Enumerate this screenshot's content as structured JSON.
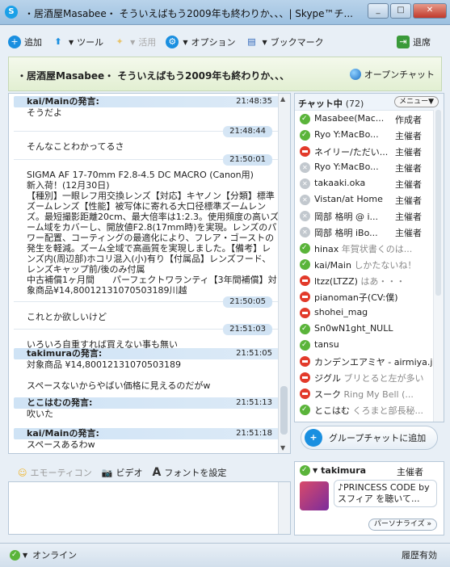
{
  "window": {
    "title": "・居酒屋Masabee・ そういえばもう2009年も終わりか、、、| Skype™チ..."
  },
  "toolbar": {
    "add": "追加",
    "tools": "ツール",
    "use": "活用",
    "options": "オプション",
    "bookmarks": "ブックマーク",
    "leave": "退席"
  },
  "topic": {
    "text": "・居酒屋Masabee・ そういえばもう2009年も終わりか、、、",
    "open_chat": "オープンチャット"
  },
  "messages": [
    {
      "sender": "kai/Mainの発言:",
      "time": "21:48:35",
      "text": "そうだよ"
    },
    {
      "sender": "",
      "time": "21:48:44",
      "text": "そんなことわかってるさ"
    },
    {
      "sender": "",
      "time": "21:50:01",
      "text": "SIGMA AF 17-70mm F2.8-4.5 DC MACRO (Canon用)\n新入荷！(12月30日)\n【種別】一眼レフ用交換レンズ【対応】キヤノン【分類】標準ズームレンズ【性能】被写体に寄れる大口径標準ズームレンズ。最短撮影距離20cm、最大倍率は1:2.3。使用頻度の高いズーム域をカバーし、開放値F2.8(17mm時)を実現。レンズのパワー配置、コーティングの最適化により、フレア・ゴーストの発生を軽減。ズーム全域で高画質を実現しました。【備考】レンズ内(周辺部)ホコリ混入(小)有り【付属品】レンズフード、レンズキャップ前/後のみ付属\n中古補償1ヶ月間　　パーフェクトワランティ【3年間補償】対象商品¥14,80012131070503189川越"
    },
    {
      "sender": "",
      "time": "21:50:05",
      "text": "これとか欲しいけど"
    },
    {
      "sender": "",
      "time": "21:51:03",
      "text": "いろいろ自重すれば買えない事も無い"
    },
    {
      "sender": "takimuraの発言:",
      "time": "21:51:05",
      "text": "対象商品 ¥14,80012131070503189\n\nスペースないからやばい価格に見えるのだがw"
    },
    {
      "sender": "とこはむの発言:",
      "time": "21:51:13",
      "text": "吹いた"
    },
    {
      "sender": "kai/Mainの発言:",
      "time": "21:51:18",
      "text": "スペースあるわw"
    }
  ],
  "input": {
    "emoticon": "エモーティコン",
    "video": "ビデオ",
    "font": "フォントを設定"
  },
  "members": {
    "label": "チャット中",
    "count": "(72)",
    "menu": "メニュー",
    "list": [
      {
        "name": "Masabee(Mac...",
        "mood": "",
        "role": "作成者",
        "status": "on"
      },
      {
        "name": "Ryo Y:MacBo...",
        "mood": "",
        "role": "主催者",
        "status": "on"
      },
      {
        "name": "ネイリー/ただい...",
        "mood": "",
        "role": "主催者",
        "status": "dnd"
      },
      {
        "name": "Ryo Y:MacBo...",
        "mood": "",
        "role": "主催者",
        "status": "off"
      },
      {
        "name": "takaaki.oka",
        "mood": "",
        "role": "主催者",
        "status": "off"
      },
      {
        "name": "Vistan/at Home",
        "mood": "",
        "role": "主催者",
        "status": "off"
      },
      {
        "name": "岡部 格明 @ i...",
        "mood": "",
        "role": "主催者",
        "status": "off"
      },
      {
        "name": "岡部 格明 iBo...",
        "mood": "",
        "role": "主催者",
        "status": "off"
      },
      {
        "name": "hinax ",
        "mood": "年賀状書くのは...",
        "role": "",
        "status": "on"
      },
      {
        "name": "kai/Main ",
        "mood": "しかたないね！",
        "role": "",
        "status": "on"
      },
      {
        "name": "ltzz(LTZZ) ",
        "mood": "はあ・・・",
        "role": "",
        "status": "dnd"
      },
      {
        "name": "pianoman子(CV:僕)",
        "mood": "",
        "role": "",
        "status": "dnd"
      },
      {
        "name": "shohei_mag",
        "mood": "",
        "role": "",
        "status": "dnd"
      },
      {
        "name": "Sn0wN1ght_NULL",
        "mood": "",
        "role": "",
        "status": "on"
      },
      {
        "name": "tansu",
        "mood": "",
        "role": "",
        "status": "on"
      },
      {
        "name": "カンデンエアミヤ - airmiya.jp",
        "mood": "",
        "role": "",
        "status": "dnd"
      },
      {
        "name": "ジグル ",
        "mood": "ブリとると左が多い",
        "role": "",
        "status": "dnd"
      },
      {
        "name": "スーク ",
        "mood": "Ring My Bell (...",
        "role": "",
        "status": "dnd"
      },
      {
        "name": "とこはむ ",
        "mood": "くろまと部長秘...",
        "role": "",
        "status": "on"
      }
    ]
  },
  "add_group": {
    "label": "グループチャットに追加"
  },
  "profile": {
    "name": "takimura",
    "role": "主催者",
    "mood": "♪PRINCESS CODE by スフィア を聴いて...",
    "button": "パーソナライズ »"
  },
  "status": {
    "online": "オンライン",
    "history": "履歴有効"
  },
  "colors": {
    "accent": "#1aa0e8",
    "online": "#5ab43a",
    "dnd": "#e23a2a",
    "header_bg": "#cfe3f5"
  }
}
